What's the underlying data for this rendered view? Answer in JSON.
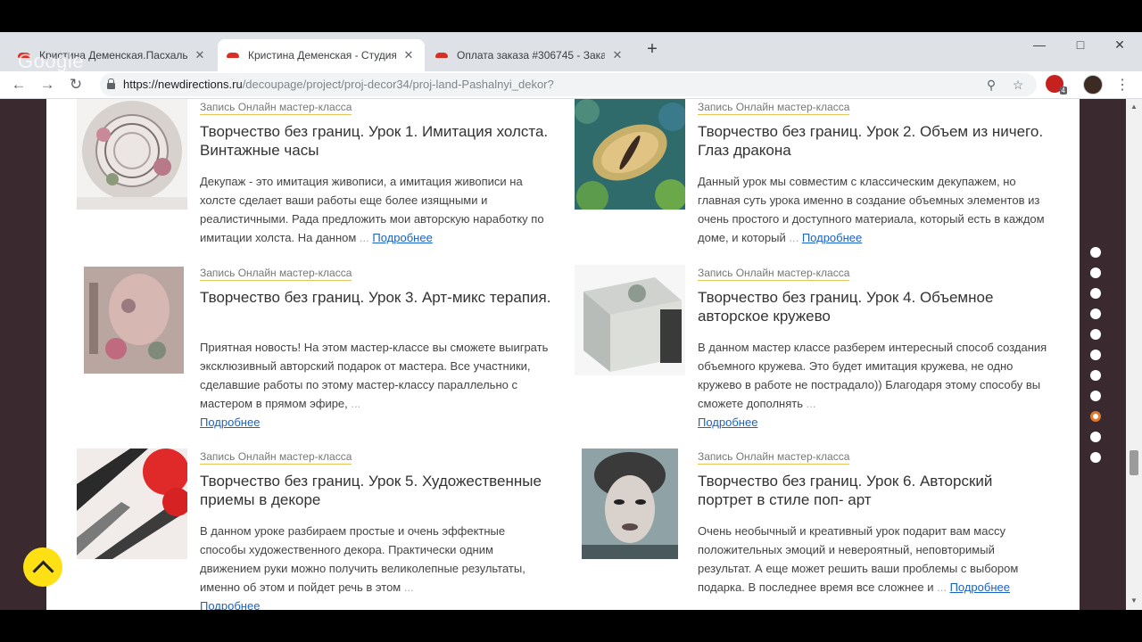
{
  "browser": {
    "tabs": [
      {
        "label": "Кристина Деменская.Пасхальны"
      },
      {
        "label": "Кристина Деменская - Студия д"
      },
      {
        "label": "Оплата заказа #306745 - Заказ"
      }
    ],
    "watermark": "Google",
    "url_host": "https://newdirections.ru",
    "url_path": "/decoupage/project/proj-decor34/proj-land-Pashalnyi_dekor?",
    "new_tab": "+",
    "close_glyph": "✕",
    "ext_badge": "4"
  },
  "cards": [
    {
      "category": "Запись Онлайн мастер-класса",
      "title": "Творчество без границ. Урок 1. Имитация холста. Винтажные часы",
      "description": "Декупаж - это имитация живописи, а имитация живописи на холсте сделает ваши работы еще более изящными и реалистичными. Рада предложить мои авторскую наработку по имитации холста.  На данном",
      "more": "Подробнее"
    },
    {
      "category": "Запись Онлайн мастер-класса",
      "title": "Творчество без границ. Урок 2. Объем из ничего. Глаз дракона",
      "description": "Данный урок мы совместим с классическим декупажем, но главная суть урока именно в создание объемных элементов из очень простого и доступного материала, который есть в каждом доме, и который",
      "more": "Подробнее"
    },
    {
      "category": "Запись Онлайн мастер-класса",
      "title": "Творчество без границ. Урок 3. Арт-микс терапия.",
      "description": "Приятная новость! На этом мастер-классе вы сможете выиграть эксклюзивный авторский подарок от мастера. Все участники, сделавшие работы по этому мастер-классу параллельно с мастером в прямом эфире,",
      "more": "Подробнее"
    },
    {
      "category": "Запись Онлайн мастер-класса",
      "title": "Творчество без границ. Урок 4. Объемное авторское кружево",
      "description": "В данном мастер классе разберем интересный способ создания объемного кружева. Это будет имитация кружева, не одно кружево в работе не пострадало)) Благодаря этому способу вы сможете дополнять",
      "more": "Подробнее"
    },
    {
      "category": "Запись Онлайн мастер-класса",
      "title": "Творчество без границ. Урок 5. Художественные приемы в декоре",
      "description": "В данном уроке разбираем простые и очень эффектные способы художественного декора.  Практически одним движением руки можно получить великолепные результаты, именно об этом и пойдет речь в этом",
      "more": "Подробнее"
    },
    {
      "category": "Запись Онлайн мастер-класса",
      "title": "Творчество без границ. Урок 6. Авторский портрет в стиле поп- арт",
      "description": "Очень необычный и креативный урок подарит вам массу положительных эмоций и невероятный, неповторимый результат. А еще может решить ваши проблемы с выбором подарка. В последнее время все сложнее и",
      "more": "Подробнее"
    }
  ],
  "ellipsis": "...",
  "colors": {
    "accent": "#ffe014",
    "link": "#1a62c5",
    "active_dot": "#e07a2a"
  }
}
